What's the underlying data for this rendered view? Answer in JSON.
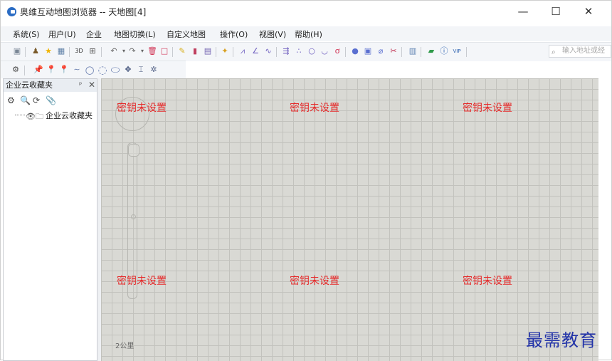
{
  "window": {
    "title": "奥维互动地图浏览器 -- 天地图[4]",
    "minimize": "—",
    "maximize": "☐",
    "close": "✕"
  },
  "menu": [
    {
      "label": "系统(S)"
    },
    {
      "label": "用户(U)"
    },
    {
      "label": "企业"
    },
    {
      "label": "地图切换(L)"
    },
    {
      "label": "自定义地图"
    },
    {
      "label": "操作(O)"
    },
    {
      "label": "视图(V)"
    },
    {
      "label": "帮助(H)"
    }
  ],
  "toolbar": {
    "address_placeholder": "输入地址或经",
    "text_3d": "3D",
    "text_vip": "VIP"
  },
  "panel": {
    "title": "企业云收藏夹",
    "pin": "ᵖ",
    "close": "✕",
    "tree_item": "企业云收藏夹"
  },
  "map": {
    "key_message": "密钥未设置",
    "scale": "2公里"
  },
  "watermark": "最需教育"
}
